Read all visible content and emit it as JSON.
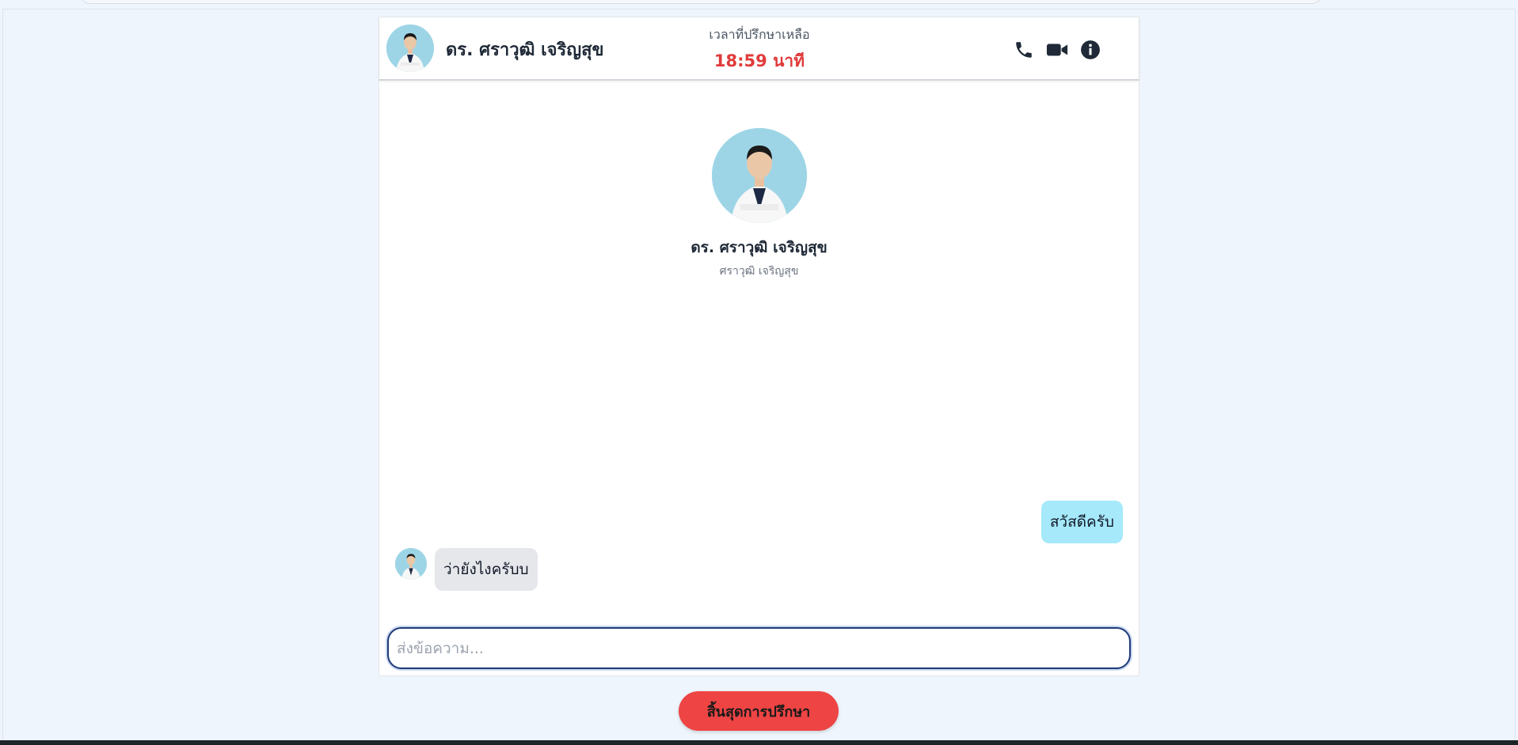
{
  "header": {
    "doctor_name": "ดร. ศราวุฒิ เจริญสุข",
    "timer_label": "เวลาที่ปรึกษาเหลือ",
    "timer_value": "18:59 นาที",
    "icons": [
      "phone-icon",
      "video-camera-icon",
      "info-icon"
    ]
  },
  "profile": {
    "name": "ดร. ศราวุฒิ เจริญสุข",
    "subtitle": "ศราวุฒิ เจริญสุข"
  },
  "messages": [
    {
      "direction": "outgoing",
      "text": "สวัสดีครับ"
    },
    {
      "direction": "incoming",
      "text": "ว่ายังไงครับบ"
    }
  ],
  "composer": {
    "placeholder": "ส่งข้อความ...",
    "value": ""
  },
  "actions": {
    "end_consultation_label": "สิ้นสุดการปรึกษา"
  },
  "colors": {
    "page_bg": "#eef5fc",
    "timer_red": "#e03a3a",
    "outgoing_bubble": "#a5e9fb",
    "incoming_bubble": "#e5e7eb",
    "end_button": "#ef4444",
    "input_border": "#1e3a78"
  }
}
